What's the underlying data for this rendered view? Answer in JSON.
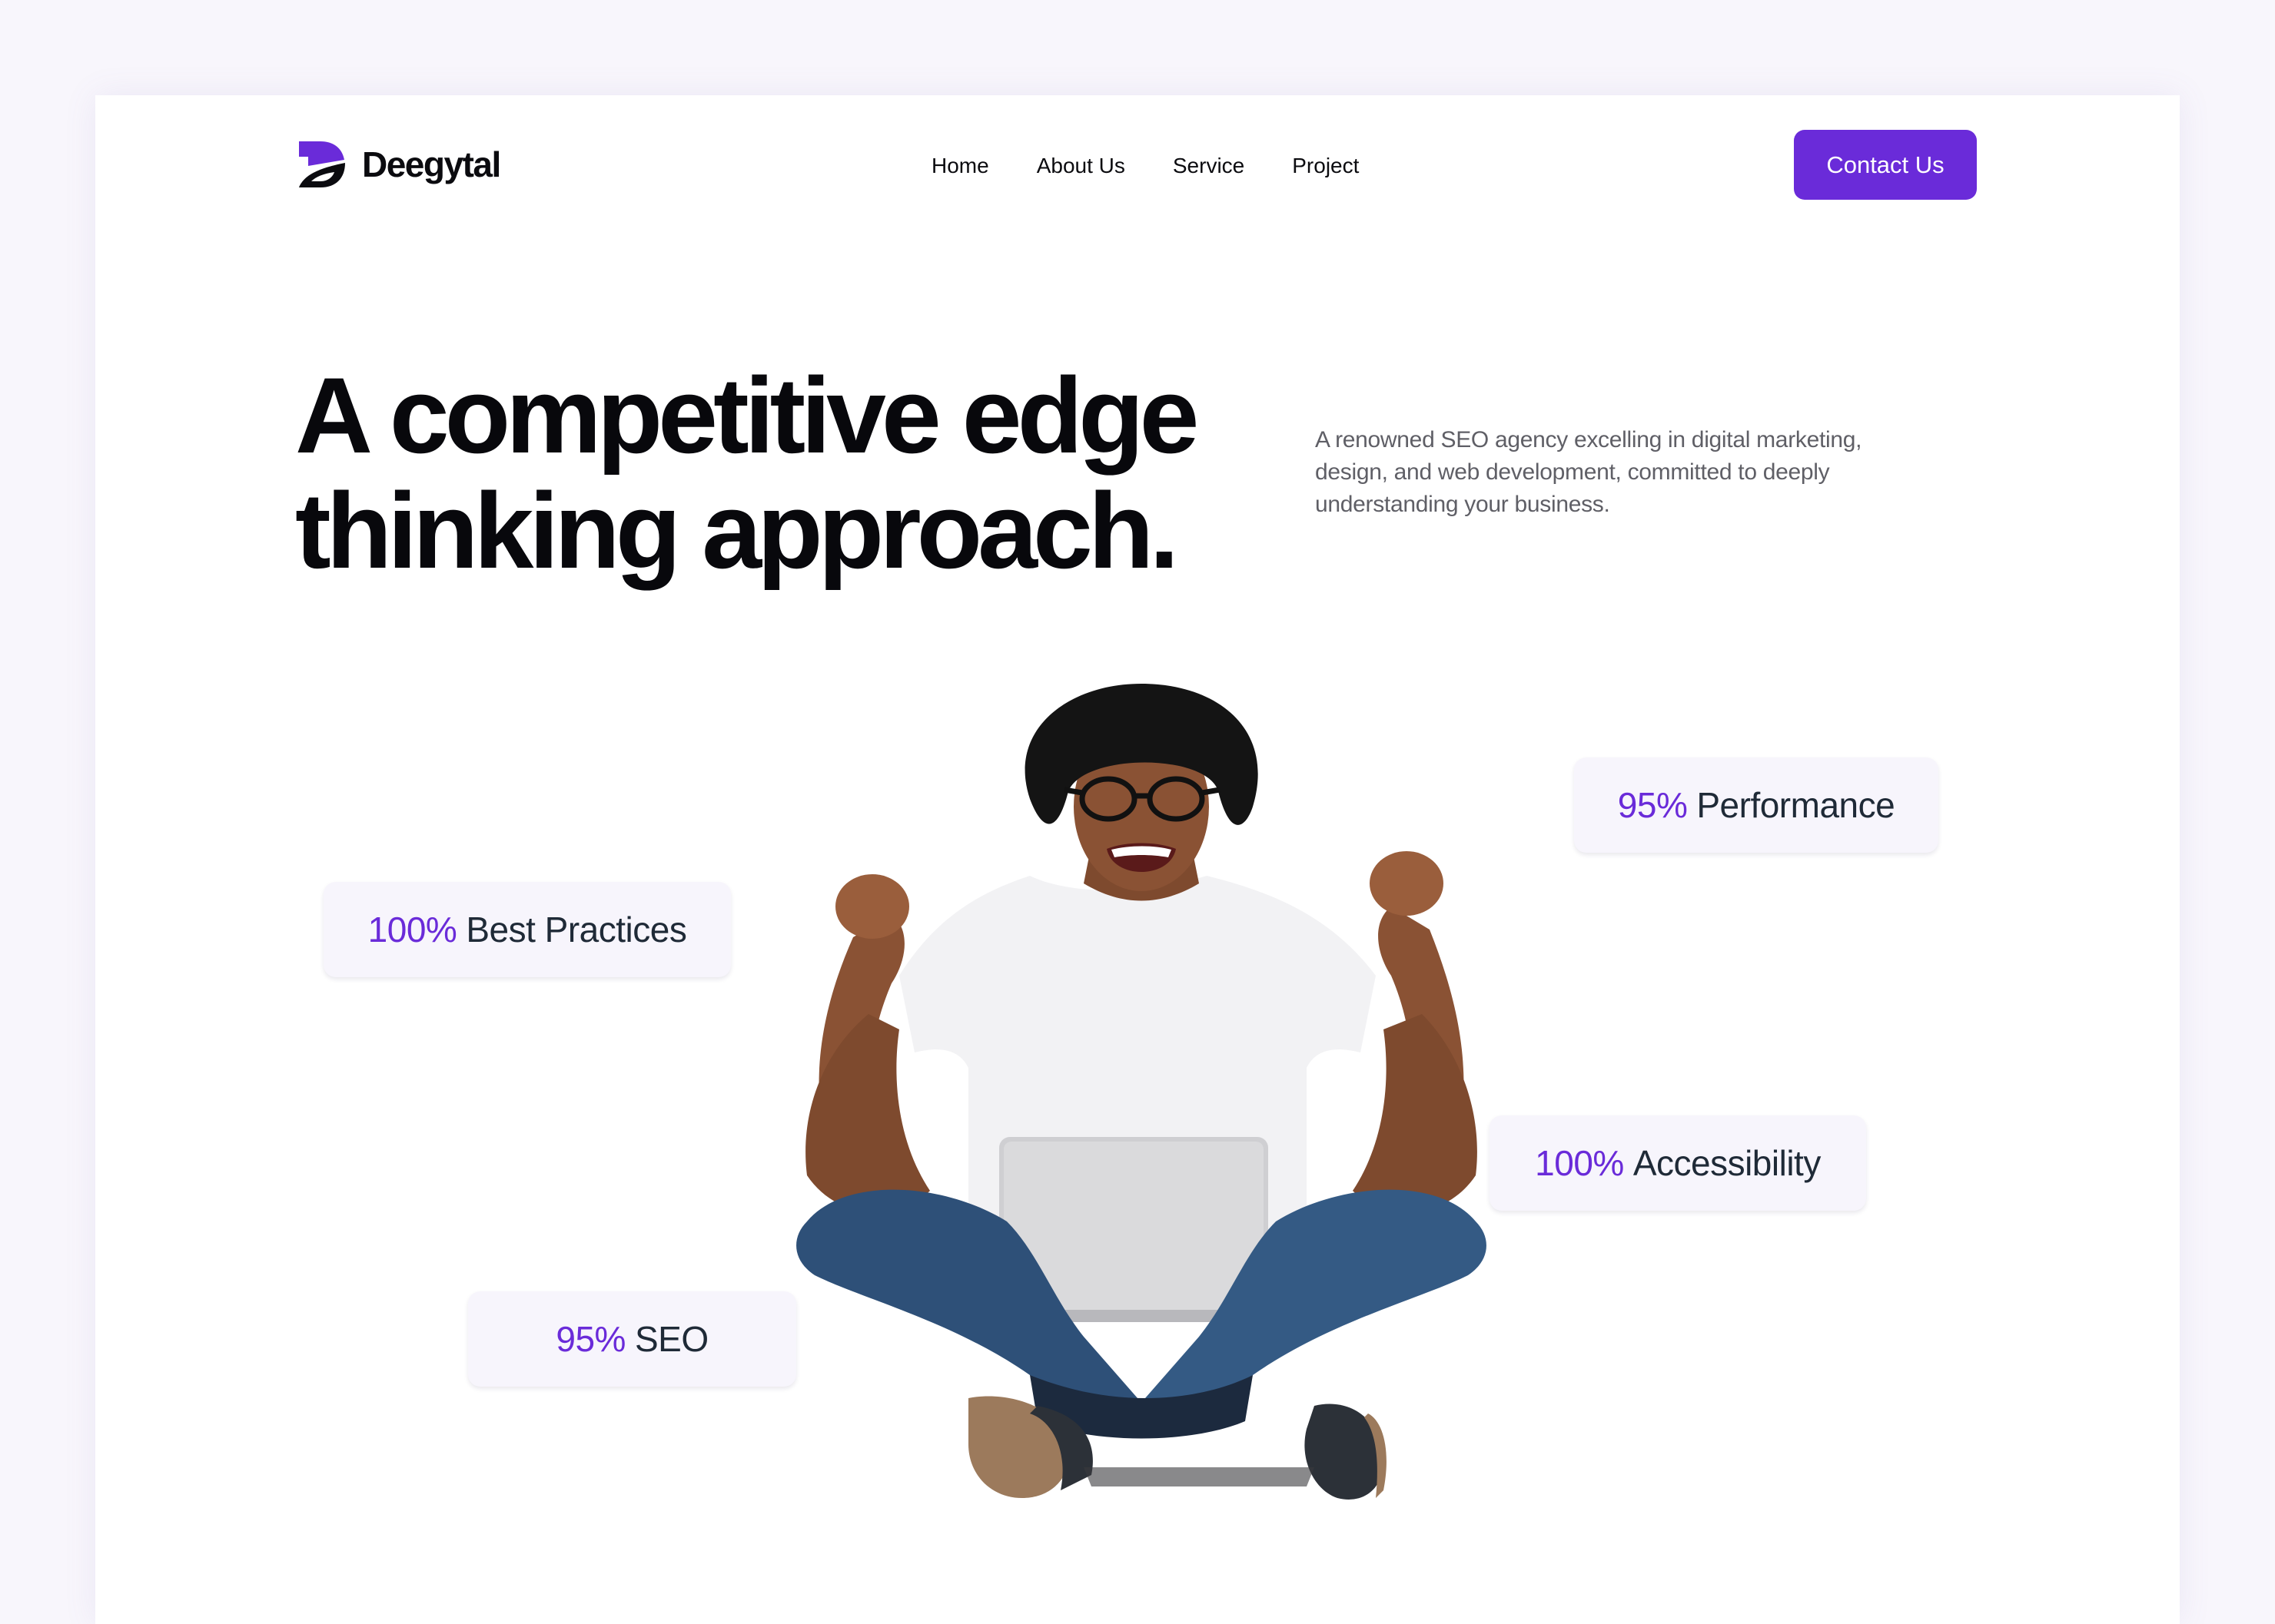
{
  "brand": {
    "name": "Deegytal",
    "logo_icon": "d-swoosh-logo-icon",
    "accent_color": "#6A2BD9"
  },
  "nav": {
    "items": [
      {
        "label": "Home"
      },
      {
        "label": "About Us"
      },
      {
        "label": "Service"
      },
      {
        "label": "Project"
      }
    ],
    "cta_label": "Contact Us"
  },
  "hero": {
    "headline_line1": "A competitive edge",
    "headline_line2": "thinking approach.",
    "description": "A renowned SEO agency excelling in digital marketing, design, and web development, committed to deeply understanding your business.",
    "image_alt": "Excited young man sitting cross-legged with a laptop, raising fists"
  },
  "stats": [
    {
      "value": "100%",
      "label": "Best Practices"
    },
    {
      "value": "95%",
      "label": "Performance"
    },
    {
      "value": "100%",
      "label": "Accessibility"
    },
    {
      "value": "95%",
      "label": "SEO"
    }
  ]
}
